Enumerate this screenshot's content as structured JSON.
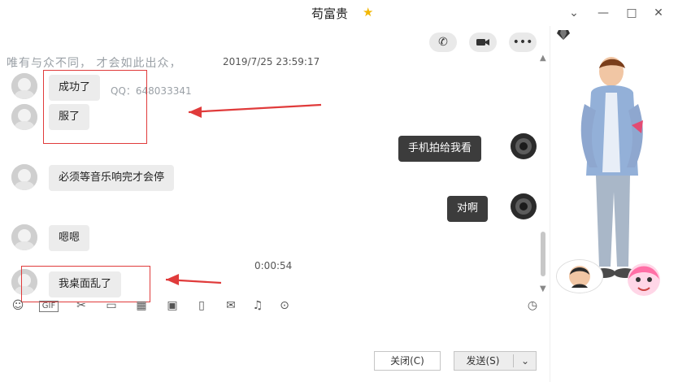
{
  "window": {
    "title": "苟富贵",
    "controls": {
      "minimize": "⌄",
      "minimize2": "—",
      "maximize": "□",
      "close": "✕"
    }
  },
  "chat": {
    "signature": "唯有与众不同， 才会如此出众，",
    "timestamp": "2019/7/25 23:59:17",
    "signature_qq": "QQ：648033341",
    "messages": [
      {
        "side": "left",
        "text": "成功了"
      },
      {
        "side": "left",
        "text": "服了"
      },
      {
        "side": "right",
        "text": "手机拍给我看"
      },
      {
        "side": "left",
        "text": "必须等音乐响完才会停"
      },
      {
        "side": "right",
        "text": "对啊"
      },
      {
        "side": "left",
        "text": "嗯嗯"
      },
      {
        "side": "center",
        "text": "0:00:54"
      },
      {
        "side": "left",
        "text": "我桌面乱了"
      }
    ]
  },
  "toolbar": {
    "icons": [
      "emoji-icon",
      "gif-icon",
      "scissors-icon",
      "folder-icon",
      "document-icon",
      "image-icon",
      "screen-capture-icon",
      "red-envelope-icon",
      "music-icon",
      "more-icon"
    ],
    "history_icon": "clock-icon",
    "gif_label": "GIF"
  },
  "buttons": {
    "close_label": "关闭(C)",
    "send_label": "发送(S)",
    "send_dropdown": "⌄"
  },
  "top_actions": {
    "call": "phone-icon",
    "video": "video-icon",
    "more": "more-icon"
  },
  "colors": {
    "bubble_left": "#ececec",
    "bubble_right": "#3c3c3c",
    "highlight": "#e03b3b",
    "title_star": "#f2b705"
  }
}
